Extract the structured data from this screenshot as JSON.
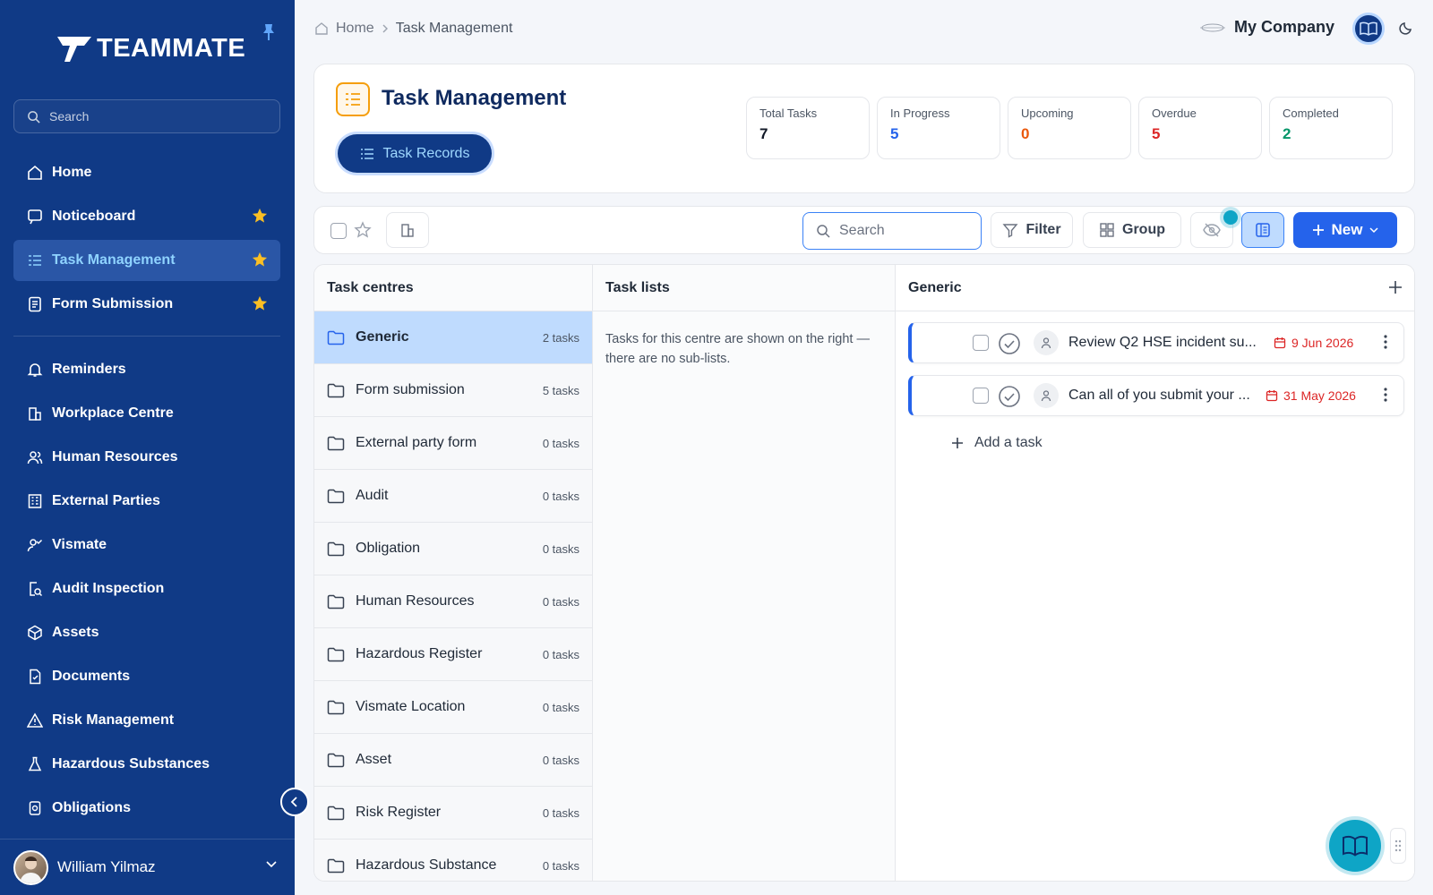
{
  "brand": {
    "name": "TEAMMATE"
  },
  "sidebar": {
    "search_placeholder": "Search",
    "items": [
      {
        "label": "Home",
        "icon": "home-icon",
        "starred": false
      },
      {
        "label": "Noticeboard",
        "icon": "noticeboard-icon",
        "starred": true
      },
      {
        "label": "Task Management",
        "icon": "task-list-icon",
        "starred": true,
        "active": true
      },
      {
        "label": "Form Submission",
        "icon": "form-icon",
        "starred": true
      },
      {
        "label": "Reminders",
        "icon": "bell-icon",
        "starred": false
      },
      {
        "label": "Workplace Centre",
        "icon": "building-icon",
        "starred": false
      },
      {
        "label": "Human Resources",
        "icon": "people-icon",
        "starred": false
      },
      {
        "label": "External Parties",
        "icon": "external-icon",
        "starred": false
      },
      {
        "label": "Vismate",
        "icon": "user-check-icon",
        "starred": false
      },
      {
        "label": "Audit Inspection",
        "icon": "audit-icon",
        "starred": false
      },
      {
        "label": "Assets",
        "icon": "box-icon",
        "starred": false
      },
      {
        "label": "Documents",
        "icon": "document-icon",
        "starred": false
      },
      {
        "label": "Risk Management",
        "icon": "warning-icon",
        "starred": false
      },
      {
        "label": "Hazardous Substances",
        "icon": "flask-icon",
        "starred": false
      },
      {
        "label": "Obligations",
        "icon": "obligation-icon",
        "starred": false
      }
    ],
    "user": {
      "name": "William Yilmaz"
    }
  },
  "breadcrumb": {
    "home": "Home",
    "current": "Task Management"
  },
  "topbar": {
    "company": "My Company"
  },
  "header": {
    "title": "Task Management",
    "records_button": "Task Records",
    "stats": [
      {
        "label": "Total Tasks",
        "value": "7",
        "color": "#111827"
      },
      {
        "label": "In Progress",
        "value": "5",
        "color": "#2563eb"
      },
      {
        "label": "Upcoming",
        "value": "0",
        "color": "#ea580c"
      },
      {
        "label": "Overdue",
        "value": "5",
        "color": "#dc2626"
      },
      {
        "label": "Completed",
        "value": "2",
        "color": "#059669"
      }
    ]
  },
  "toolbar": {
    "search_placeholder": "Search",
    "filter_label": "Filter",
    "group_label": "Group",
    "new_label": "New"
  },
  "panels": {
    "centres_header": "Task centres",
    "lists_header": "Task lists",
    "tasks_header": "Generic",
    "lists_note": "Tasks for this centre are shown on the right — there are no sub-lists.",
    "centres": [
      {
        "name": "Generic",
        "count": "2 tasks",
        "active": true
      },
      {
        "name": "Form submission",
        "count": "5 tasks"
      },
      {
        "name": "External party form",
        "count": "0 tasks"
      },
      {
        "name": "Audit",
        "count": "0 tasks"
      },
      {
        "name": "Obligation",
        "count": "0 tasks"
      },
      {
        "name": "Human Resources",
        "count": "0 tasks"
      },
      {
        "name": "Hazardous Register",
        "count": "0 tasks"
      },
      {
        "name": "Vismate Location",
        "count": "0 tasks"
      },
      {
        "name": "Asset",
        "count": "0 tasks"
      },
      {
        "name": "Risk Register",
        "count": "0 tasks"
      },
      {
        "name": "Hazardous Substance",
        "count": "0 tasks"
      }
    ],
    "tasks": [
      {
        "title": "Review Q2 HSE incident su...",
        "date": "9 Jun 2026"
      },
      {
        "title": "Can all of you submit your ...",
        "date": "31 May 2026"
      }
    ],
    "add_task_label": "Add a task"
  },
  "colors": {
    "sidebar": "#103a86",
    "accent": "#2563eb",
    "active_row": "#bfdbfe"
  }
}
